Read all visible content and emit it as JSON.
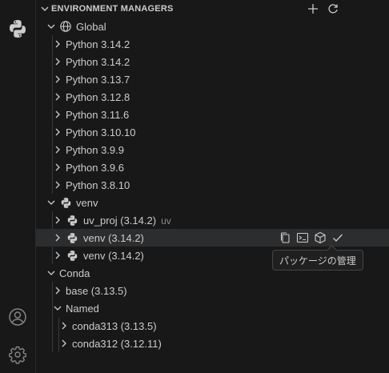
{
  "section": {
    "title": "ENVIRONMENT MANAGERS"
  },
  "tree": {
    "global": {
      "label": "Global",
      "items": [
        "Python 3.14.2",
        "Python 3.14.2",
        "Python 3.13.7",
        "Python 3.12.8",
        "Python 3.11.6",
        "Python 3.10.10",
        "Python 3.9.9",
        "Python 3.9.6",
        "Python 3.8.10"
      ]
    },
    "venv": {
      "label": "venv",
      "items": [
        {
          "label": "uv_proj (3.14.2)",
          "desc": "uv"
        },
        {
          "label": "venv (3.14.2)",
          "desc": ""
        },
        {
          "label": "venv (3.14.2)",
          "desc": ""
        }
      ]
    },
    "conda": {
      "label": "Conda",
      "base": "base (3.13.5)",
      "named": {
        "label": "Named",
        "items": [
          "conda313 (3.13.5)",
          "conda312 (3.12.11)"
        ]
      }
    }
  },
  "tooltip": {
    "text": "パッケージの管理"
  },
  "colors": {
    "selected_row": "#2b2d2e",
    "python_blue": "#3b7bbf",
    "python_yellow": "#f2c94c"
  }
}
